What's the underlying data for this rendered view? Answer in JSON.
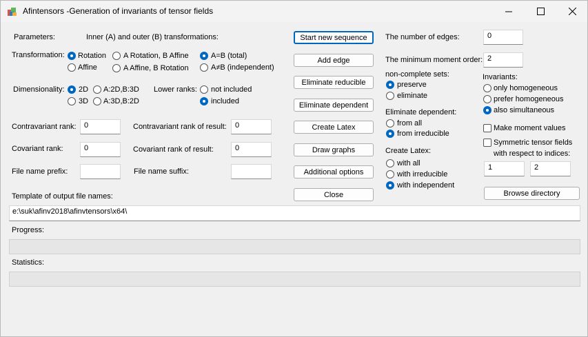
{
  "window": {
    "title": "Afintensors -Generation of invariants of tensor fields",
    "controls": {
      "minimize": "—",
      "maximize": "☐",
      "close": "✕"
    }
  },
  "params": {
    "parameters_label": "Parameters:",
    "inner_outer_label": "Inner (A) and outer (B) transformations:",
    "transformation_label": "Transformation:",
    "rotation": "Rotation",
    "affine": "Affine",
    "a_rot_b_aff": "A Rotation, B Affine",
    "a_aff_b_rot": "A Affine, B Rotation",
    "a_eq_b": "A=B (total)",
    "a_ne_b": "A≠B (independent)",
    "dimensionality_label": "Dimensionality:",
    "dim_2d": "2D",
    "dim_3d": "3D",
    "dim_a2_b3": "A:2D,B:3D",
    "dim_a3_b2": "A:3D,B:2D",
    "lower_ranks_label": "Lower ranks:",
    "not_included": "not included",
    "included": "included",
    "contra_rank_label": "Contravariant rank:",
    "contra_rank_value": "0",
    "contra_result_label": "Contravariant rank of result:",
    "contra_result_value": "0",
    "cov_rank_label": "Covariant rank:",
    "cov_rank_value": "0",
    "cov_result_label": "Covariant rank of result:",
    "cov_result_value": "0",
    "prefix_label": "File name prefix:",
    "prefix_value": "",
    "suffix_label": "File name suffix:",
    "suffix_value": "",
    "template_label": "Template of output file names:",
    "template_value": "e:\\suk\\afinv2018\\afinvtensors\\x64\\"
  },
  "buttons": {
    "start": "Start new sequence",
    "add_edge": "Add edge",
    "elim_reducible": "Eliminate reducible",
    "elim_dependent": "Eliminate dependent",
    "create_latex": "Create Latex",
    "draw_graphs": "Draw graphs",
    "additional": "Additional options",
    "close": "Close",
    "browse": "Browse directory"
  },
  "right": {
    "edges_label": "The number of edges:",
    "edges_value": "0",
    "min_moment_label": "The minimum moment order:",
    "min_moment_value": "2",
    "noncomplete_label": "non-complete sets:",
    "preserve": "preserve",
    "eliminate": "eliminate",
    "elim_dep_label": "Eliminate dependent:",
    "from_all": "from all",
    "from_irreducible": "from irreducible",
    "create_latex_label": "Create Latex:",
    "with_all": "with all",
    "with_irreducible": "with irreducible",
    "with_independent": "with independent",
    "invariants_label": "Invariants:",
    "only_homogeneous": "only homogeneous",
    "prefer_homogeneous": "prefer homogeneous",
    "also_simultaneous": "also simultaneous",
    "make_moment": "Make moment values",
    "symmetric_line1": "Symmetric tensor fields",
    "symmetric_line2": "with respect to indices:",
    "index1": "1",
    "index2": "2"
  },
  "bottom": {
    "progress_label": "Progress:",
    "statistics_label": "Statistics:"
  }
}
